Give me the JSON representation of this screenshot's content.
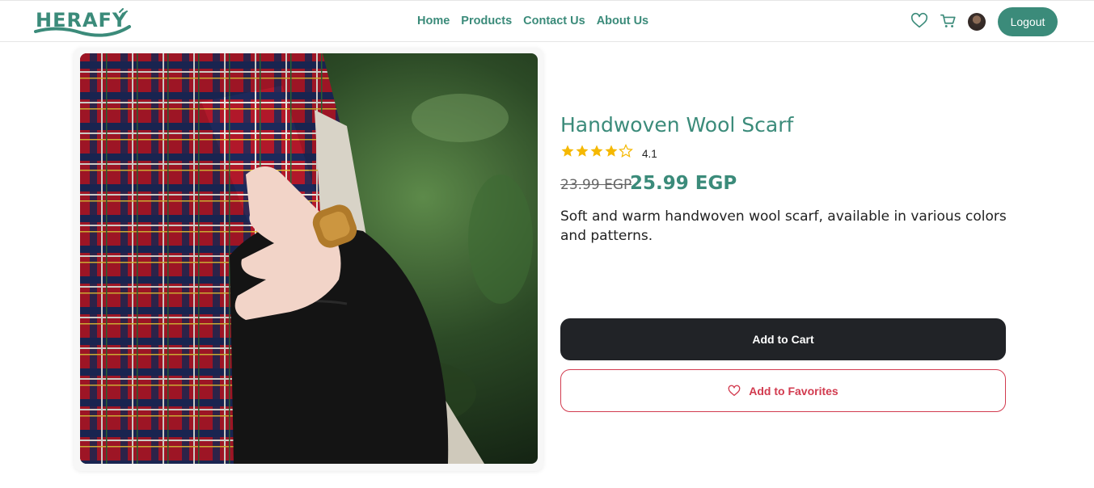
{
  "brand": {
    "logo_text": "HERAFY",
    "color": "#3b8b7a"
  },
  "nav": {
    "links": [
      "Home",
      "Products",
      "Contact Us",
      "About Us"
    ],
    "icons": [
      "heart-icon",
      "cart-icon"
    ],
    "logout_label": "Logout"
  },
  "product": {
    "title": "Handwoven Wool Scarf",
    "rating": "4.1",
    "rating_value": 4.1,
    "rating_max": 5,
    "old_price": "23.99 EGP",
    "new_price": "25.99 EGP",
    "description": "Soft and warm handwoven wool scarf, available in various colors and patterns.",
    "add_to_cart_label": "Add to Cart",
    "add_to_favorites_label": "Add to Favorites"
  },
  "colors": {
    "accent": "#3b8b7a",
    "dark_button": "#212327",
    "favorite_red": "#d23b4f",
    "star": "#f5b800"
  }
}
